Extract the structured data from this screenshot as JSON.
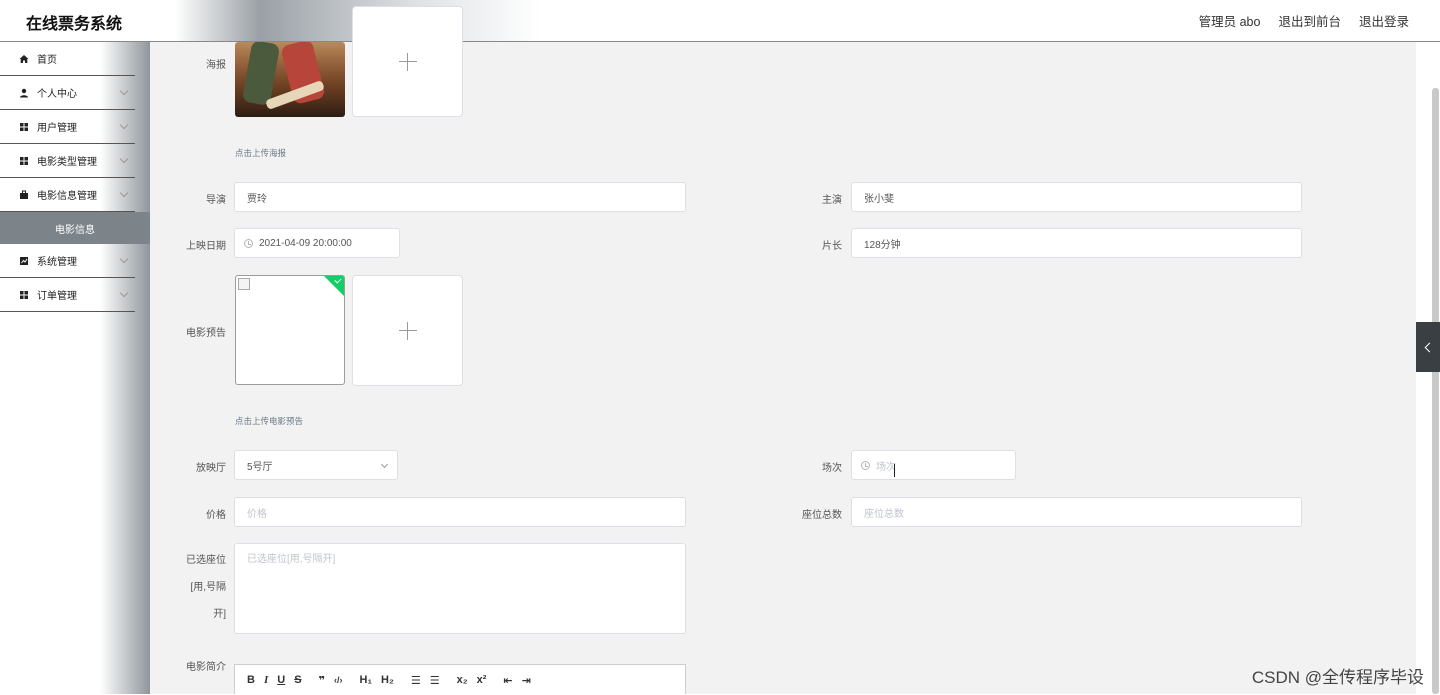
{
  "header": {
    "app_title": "在线票务系统",
    "admin_label": "管理员 abo",
    "to_front": "退出到前台",
    "logout": "退出登录"
  },
  "sidebar": {
    "items": [
      {
        "label": "首页",
        "icon": "home-icon",
        "has_children": false
      },
      {
        "label": "个人中心",
        "icon": "user-icon",
        "has_children": true
      },
      {
        "label": "用户管理",
        "icon": "grid-icon",
        "has_children": true
      },
      {
        "label": "电影类型管理",
        "icon": "grid-icon",
        "has_children": true
      },
      {
        "label": "电影信息管理",
        "icon": "briefcase-icon",
        "has_children": true
      },
      {
        "label": "电影信息",
        "is_submenu_active": true
      },
      {
        "label": "系统管理",
        "icon": "chart-icon",
        "has_children": true
      },
      {
        "label": "订单管理",
        "icon": "grid-icon",
        "has_children": true
      }
    ]
  },
  "form": {
    "poster_label": "海报",
    "poster_hint": "点击上传海报",
    "director_label": "导演",
    "director_value": "贾玲",
    "lead_label": "主演",
    "lead_value": "张小斐",
    "release_label": "上映日期",
    "release_value": "2021-04-09 20:00:00",
    "duration_label": "片长",
    "duration_value": "128分钟",
    "trailer_label": "电影预告",
    "trailer_hint": "点击上传电影预告",
    "hall_label": "放映厅",
    "hall_value": "5号厅",
    "session_label": "场次",
    "session_placeholder": "场次",
    "price_label": "价格",
    "price_placeholder": "价格",
    "seats_label": "座位总数",
    "seats_placeholder": "座位总数",
    "selected_label_1": "已选座位",
    "selected_label_2": "[用,号隔",
    "selected_label_3": "开]",
    "selected_placeholder": "已选座位[用,号隔开]",
    "intro_label": "电影简介"
  },
  "editor_toolbar": [
    "B",
    "I",
    "U",
    "S",
    "99",
    "</>",
    "H1",
    "H2",
    "ol",
    "ul",
    "x2",
    "x2",
    "outdent",
    "indent"
  ],
  "watermark": "CSDN @全传程序毕设",
  "colors": {
    "accent_green": "#13ce66",
    "sidebar_active": "#7d8489"
  }
}
